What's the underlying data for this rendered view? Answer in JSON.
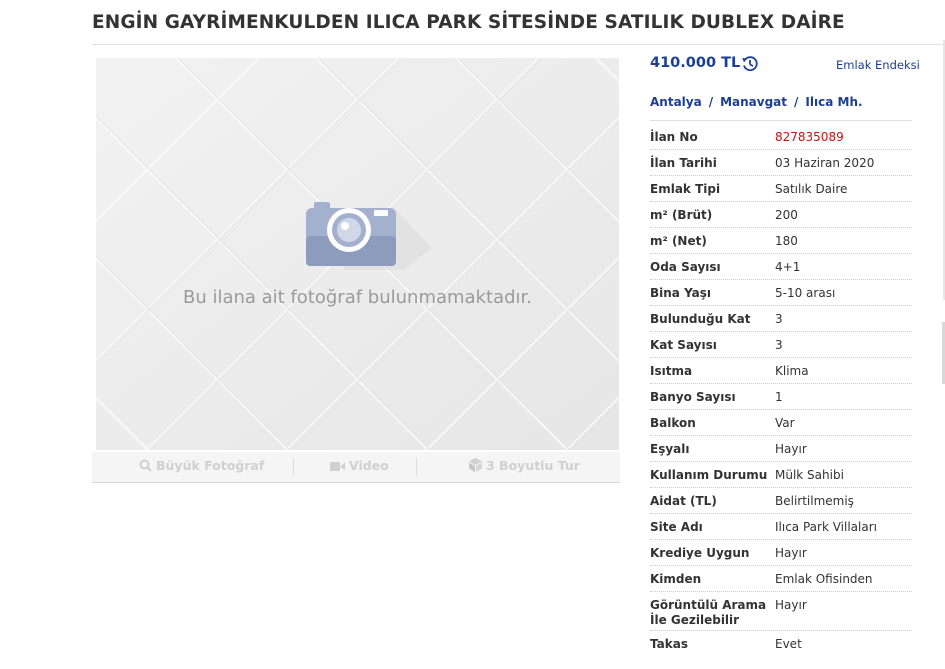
{
  "listing": {
    "title": "ENGİN GAYRİMENKULDEN ILICA PARK SİTESİNDE SATILIK DUBLEX DAİRE",
    "price": "410.000 TL",
    "index_link": "Emlak Endeksi",
    "no_photo_text": "Bu ilana ait fotoğraf bulunmamaktadır."
  },
  "media": {
    "big_photo": "Büyük Fotoğraf",
    "video": "Video",
    "tour3d": "3 Boyutlu Tur"
  },
  "breadcrumb": {
    "city": "Antalya",
    "district": "Manavgat",
    "neighborhood": "Ilıca Mh.",
    "separator": "/"
  },
  "details": [
    {
      "label": "İlan No",
      "value": "827835089"
    },
    {
      "label": "İlan Tarihi",
      "value": "03 Haziran 2020"
    },
    {
      "label": "Emlak Tipi",
      "value": "Satılık Daire"
    },
    {
      "label": "m² (Brüt)",
      "value": "200"
    },
    {
      "label": "m² (Net)",
      "value": "180"
    },
    {
      "label": "Oda Sayısı",
      "value": "4+1"
    },
    {
      "label": "Bina Yaşı",
      "value": "5-10 arası"
    },
    {
      "label": "Bulunduğu Kat",
      "value": "3"
    },
    {
      "label": "Kat Sayısı",
      "value": "3"
    },
    {
      "label": "Isıtma",
      "value": "Klima"
    },
    {
      "label": "Banyo Sayısı",
      "value": "1"
    },
    {
      "label": "Balkon",
      "value": "Var"
    },
    {
      "label": "Eşyalı",
      "value": "Hayır"
    },
    {
      "label": "Kullanım Durumu",
      "value": "Mülk Sahibi"
    },
    {
      "label": "Aidat (TL)",
      "value": "Belirtilmemiş"
    },
    {
      "label": "Site Adı",
      "value": "Ilıca Park Villaları"
    },
    {
      "label": "Krediye Uygun",
      "value": "Hayır"
    },
    {
      "label": "Kimden",
      "value": "Emlak Ofisinden"
    },
    {
      "label": "Görüntülü Arama İle Gezilebilir",
      "value": "Hayır"
    },
    {
      "label": "Takas",
      "value": "Evet"
    }
  ],
  "colors": {
    "accent_blue": "#1c3f94",
    "listing_no_red": "#cc0f0f",
    "camera_blue": "#a3b1cf"
  },
  "icons": {
    "price_history": "history-icon",
    "no_photo": "camera-icon",
    "big_photo": "magnifier-icon",
    "video": "video-camera-icon",
    "tour3d": "cube-icon"
  }
}
